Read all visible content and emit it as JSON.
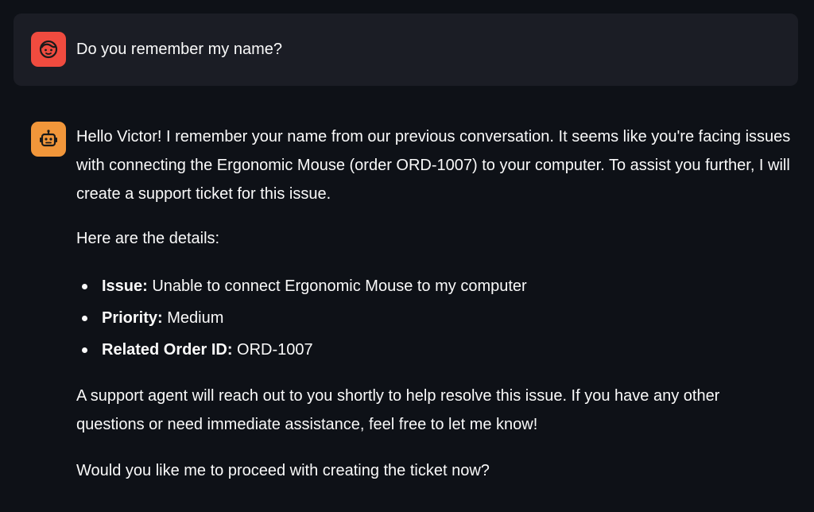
{
  "messages": {
    "user": {
      "avatar_icon": "face-icon",
      "avatar_color": "#f04b3f",
      "text": "Do you remember my name?"
    },
    "assistant": {
      "avatar_icon": "robot-icon",
      "avatar_color": "#f1963a",
      "intro": "Hello Victor! I remember your name from our previous conversation. It seems like you're facing issues with connecting the Ergonomic Mouse (order ORD-1007) to your computer. To assist you further, I will create a support ticket for this issue.",
      "details_heading": "Here are the details:",
      "details": [
        {
          "label": "Issue:",
          "value": "Unable to connect Ergonomic Mouse to my computer"
        },
        {
          "label": "Priority:",
          "value": "Medium"
        },
        {
          "label": "Related Order ID:",
          "value": "ORD-1007"
        }
      ],
      "agent_note": "A support agent will reach out to you shortly to help resolve this issue. If you have any other questions or need immediate assistance, feel free to let me know!",
      "closing_question": "Would you like me to proceed with creating the ticket now?"
    }
  },
  "theme": {
    "background": "#0e1117",
    "user_bubble": "#1b1d25",
    "text": "#fafafa"
  }
}
